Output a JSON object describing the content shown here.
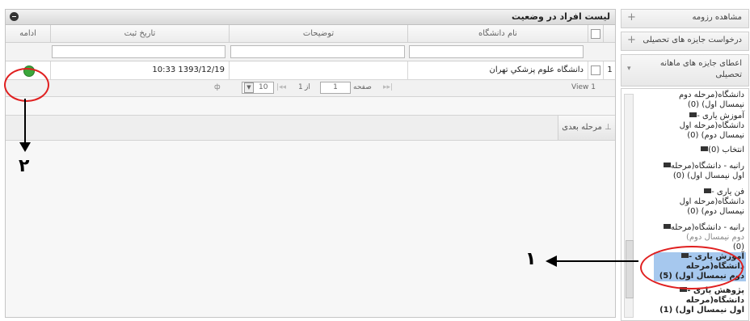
{
  "grid": {
    "title": "لیست افراد در وضعیت",
    "columns": [
      "نام دانشگاه",
      "توضیحات",
      "تاریخ ثبت",
      "ادامه"
    ],
    "row": {
      "index": "1",
      "university": "دانشگاه علوم پزشکي تهران",
      "date": "10:33 1393/12/19"
    },
    "pager": {
      "view": "View 1",
      "page_label": "صفحه",
      "page_value": "1",
      "of_label": "از",
      "total": "1",
      "page_size": "10",
      "refresh": "ф"
    },
    "next_step": "مرحله بعدی"
  },
  "sidebar": {
    "accordion": [
      {
        "label": "مشاهده رزومه",
        "icon": "+"
      },
      {
        "label": "درخواست جایزه های تحصیلی",
        "icon": "+"
      },
      {
        "label": "اعطای جایزه های ماهانه تحصیلی",
        "icon": "▾"
      }
    ],
    "tree": [
      "دانشگاه(مرحله دوم",
      "نیمسال اول) (0)",
      "آموزش یاری -",
      "دانشگاه(مرحله اول",
      "نیمسال دوم) (0)",
      "انتخاب (0)",
      "رانبه - دانشگاه(مرحله",
      "اول نیمسال اول) (0)",
      "فن یاری -",
      "دانشگاه(مرحله اول",
      "نیمسال دوم) (0)",
      "رانبه - دانشگاه(مرحله",
      "دوم نیمسال دوم)",
      "(0)",
      "آموزش یاری -",
      "دانشگاه(مرحله",
      "دوم نیمسال اول) (5)",
      "پژوهش یاری -",
      "دانشگاه(مرحله",
      "اول نیمسال اول) (1)"
    ]
  },
  "annotations": {
    "label_1": "۱",
    "label_2": "۲"
  },
  "colors": {
    "accent": "#a6c8ee",
    "circle": "#e02020",
    "go": "#3ba63b"
  }
}
